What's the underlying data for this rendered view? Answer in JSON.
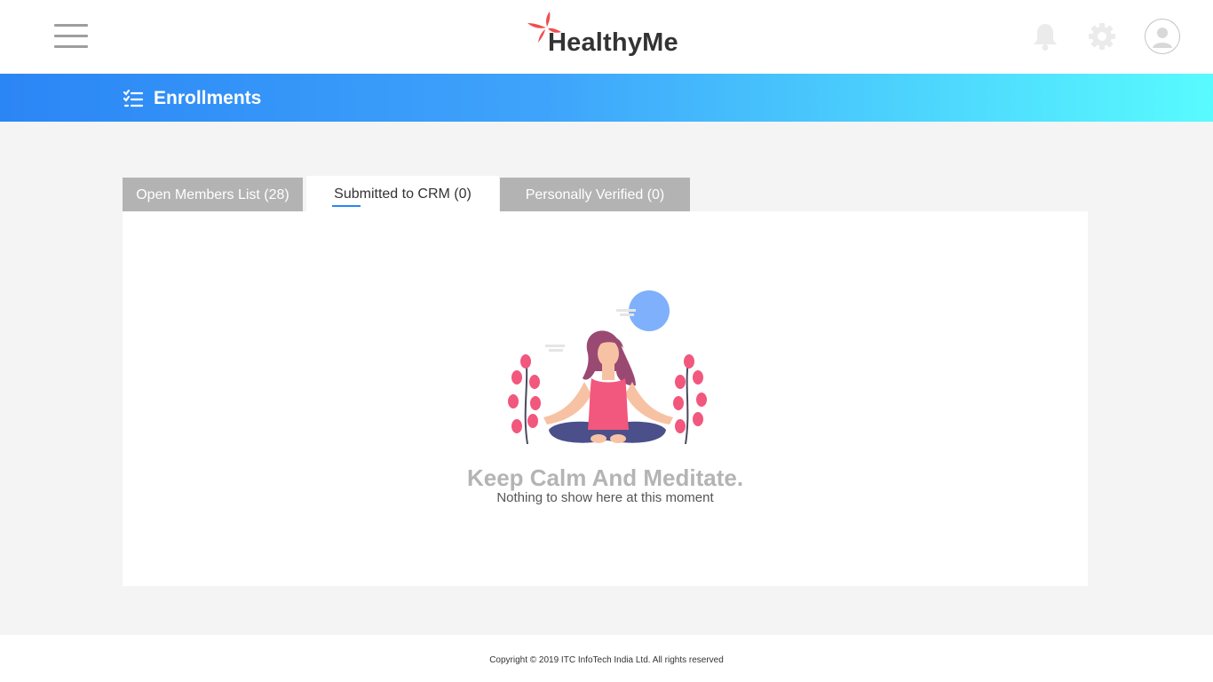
{
  "header": {
    "menu_icon": "hamburger-menu-icon",
    "brand": "HealthyMe",
    "brand_colors": {
      "petal": "#f04e4e",
      "text": "#333333"
    },
    "icons": [
      "bell-icon",
      "gear-icon",
      "user-avatar-icon"
    ]
  },
  "banner": {
    "icon": "checklist-icon",
    "title": "Enrollments",
    "gradient": [
      "#2b86f5",
      "#58fbff"
    ]
  },
  "tabs": [
    {
      "label": "Open Members List (28)",
      "active": false
    },
    {
      "label": "Submitted to CRM (0)",
      "active": true
    },
    {
      "label": "Personally Verified (0)",
      "active": false
    }
  ],
  "empty_state": {
    "illustration": "meditating-woman-illustration",
    "title": "Keep Calm And Meditate.",
    "subtitle": "Nothing to show here at this moment"
  },
  "footer": {
    "copyright": "Copyright © 2019 ITC InfoTech India Ltd. All rights reserved"
  },
  "colors": {
    "accent": "#2b86f5",
    "tab_inactive": "#b3b3b3",
    "page_bg": "#f4f4f4"
  }
}
